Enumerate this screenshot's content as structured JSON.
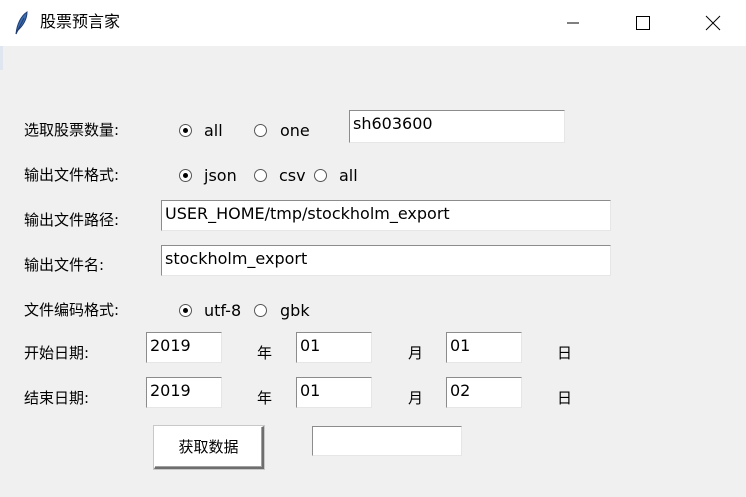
{
  "window": {
    "title": "股票预言家",
    "app_icon": "feather-icon",
    "controls": [
      "minimize-icon",
      "maximize-icon",
      "close-icon"
    ]
  },
  "form": {
    "stock_count": {
      "label": "选取股票数量:",
      "options": [
        {
          "label": "all",
          "selected": true
        },
        {
          "label": "one",
          "selected": false
        }
      ],
      "code_value": "sh603600"
    },
    "output_format": {
      "label": "输出文件格式:",
      "options": [
        {
          "label": "json",
          "selected": true
        },
        {
          "label": "csv",
          "selected": false
        },
        {
          "label": "all",
          "selected": false
        }
      ]
    },
    "output_path": {
      "label": "输出文件路径:",
      "value": "USER_HOME/tmp/stockholm_export"
    },
    "output_name": {
      "label": "输出文件名:",
      "value": "stockholm_export"
    },
    "encoding": {
      "label": "文件编码格式:",
      "options": [
        {
          "label": "utf-8",
          "selected": true
        },
        {
          "label": "gbk",
          "selected": false
        }
      ]
    },
    "start_date": {
      "label": "开始日期:",
      "year": "2019",
      "month": "01",
      "day": "01",
      "year_unit": "年",
      "month_unit": "月",
      "day_unit": "日"
    },
    "end_date": {
      "label": "结束日期:",
      "year": "2019",
      "month": "01",
      "day": "02",
      "year_unit": "年",
      "month_unit": "月",
      "day_unit": "日"
    },
    "fetch_button": "获取数据",
    "status_value": ""
  }
}
